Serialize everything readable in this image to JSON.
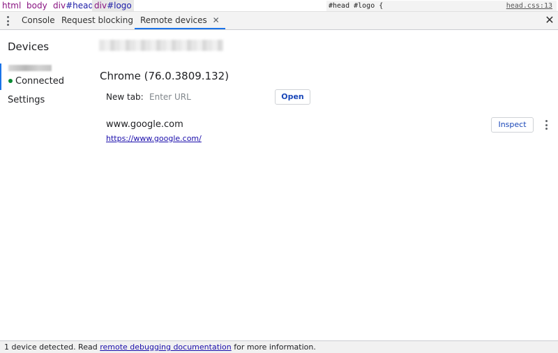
{
  "breadcrumbs": {
    "items": [
      {
        "text": "html"
      },
      {
        "text": "body"
      },
      {
        "tag": "div",
        "id": "#head"
      },
      {
        "tag": "div",
        "id": "#logo"
      }
    ],
    "rule_preview": "#head #logo {",
    "rule_source": "head.css:13"
  },
  "tabs": {
    "items": [
      {
        "label": "Console"
      },
      {
        "label": "Request blocking"
      },
      {
        "label": "Remote devices",
        "active": true
      }
    ],
    "close_glyph": "✕",
    "drawer_close_glyph": "✕"
  },
  "sidebar": {
    "title": "Devices",
    "device_status": "Connected",
    "settings_label": "Settings",
    "status_color": "#0a8a33"
  },
  "main": {
    "browser_title": "Chrome (76.0.3809.132)",
    "new_tab_label": "New tab:",
    "url_placeholder": "Enter URL",
    "open_button": "Open",
    "page": {
      "title": "www.google.com",
      "url": "https://www.google.com/",
      "inspect_button": "Inspect"
    }
  },
  "status_bar": {
    "prefix": "1 device detected. Read ",
    "link": "remote debugging documentation",
    "suffix": " for more information."
  },
  "colors": {
    "accent": "#1a73e8",
    "link": "#1a0dab",
    "button_text": "#1a47b8",
    "breadcrumb_tag": "#881280"
  }
}
